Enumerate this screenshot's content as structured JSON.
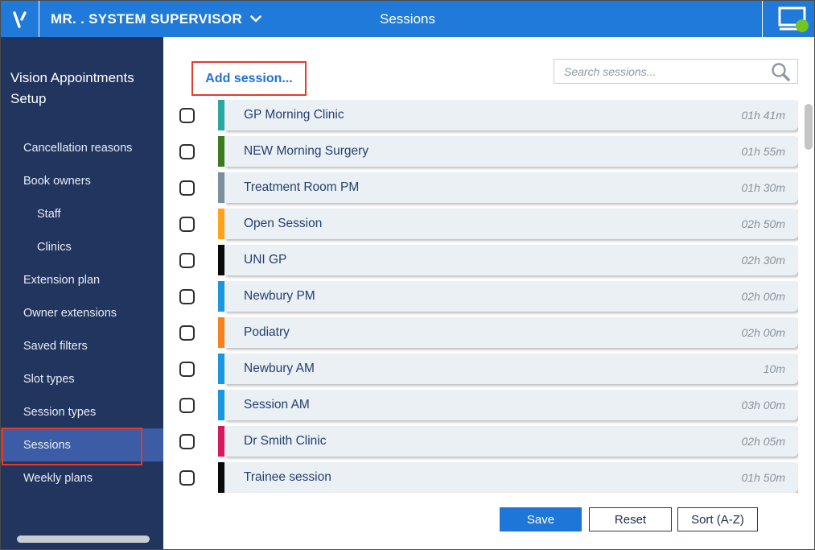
{
  "header": {
    "logo": "vision-v-logo",
    "user_menu": "MR. . SYSTEM SUPERVISOR",
    "title": "Sessions",
    "status_icon": "monitor-online"
  },
  "sidebar": {
    "title": "Vision Appointments Setup",
    "items": [
      {
        "label": "Cancellation reasons",
        "indent": false,
        "selected": false,
        "annotated": false
      },
      {
        "label": "Book owners",
        "indent": false,
        "selected": false,
        "annotated": false
      },
      {
        "label": "Staff",
        "indent": true,
        "selected": false,
        "annotated": false
      },
      {
        "label": "Clinics",
        "indent": true,
        "selected": false,
        "annotated": false
      },
      {
        "label": "Extension plan",
        "indent": false,
        "selected": false,
        "annotated": false
      },
      {
        "label": "Owner extensions",
        "indent": false,
        "selected": false,
        "annotated": false
      },
      {
        "label": "Saved filters",
        "indent": false,
        "selected": false,
        "annotated": false
      },
      {
        "label": "Slot types",
        "indent": false,
        "selected": false,
        "annotated": false
      },
      {
        "label": "Session types",
        "indent": false,
        "selected": false,
        "annotated": false
      },
      {
        "label": "Sessions",
        "indent": false,
        "selected": true,
        "annotated": true
      },
      {
        "label": "Weekly plans",
        "indent": false,
        "selected": false,
        "annotated": false
      }
    ]
  },
  "main": {
    "add_session_label": "Add session...",
    "search": {
      "placeholder": "Search sessions..."
    },
    "sessions": [
      {
        "name": "GP Morning Clinic",
        "duration": "01h 41m",
        "color": "#2aa8a0"
      },
      {
        "name": "NEW Morning Surgery",
        "duration": "01h 55m",
        "color": "#3c7b1f"
      },
      {
        "name": "Treatment Room PM",
        "duration": "01h 30m",
        "color": "#7a909e"
      },
      {
        "name": "Open Session",
        "duration": "02h 50m",
        "color": "#ffa21c"
      },
      {
        "name": "UNI GP",
        "duration": "02h 30m",
        "color": "#0a0a0a"
      },
      {
        "name": "Newbury PM",
        "duration": "02h 00m",
        "color": "#1b97e0"
      },
      {
        "name": "Podiatry",
        "duration": "02h 00m",
        "color": "#f58220"
      },
      {
        "name": "Newbury AM",
        "duration": "10m",
        "color": "#1b97e0"
      },
      {
        "name": "Session AM",
        "duration": "03h 00m",
        "color": "#1b97e0"
      },
      {
        "name": "Dr Smith Clinic",
        "duration": "02h 05m",
        "color": "#d6185e"
      },
      {
        "name": "Trainee session",
        "duration": "01h 50m",
        "color": "#0a0a0a"
      }
    ],
    "buttons": {
      "save": "Save",
      "reset": "Reset",
      "sort": "Sort (A-Z)"
    }
  },
  "colors": {
    "header_blue": "#1f7ad9",
    "sidebar_navy": "#22355f",
    "selected_item_blue": "#3c5ca6",
    "annotation_red": "#e23b2c",
    "link_blue": "#2072d8",
    "save_button_blue": "#1e76d8",
    "row_background": "#eaf0f4",
    "session_name_text": "#24406e",
    "duration_text": "#8a929b",
    "online_status_green": "#76c420"
  }
}
